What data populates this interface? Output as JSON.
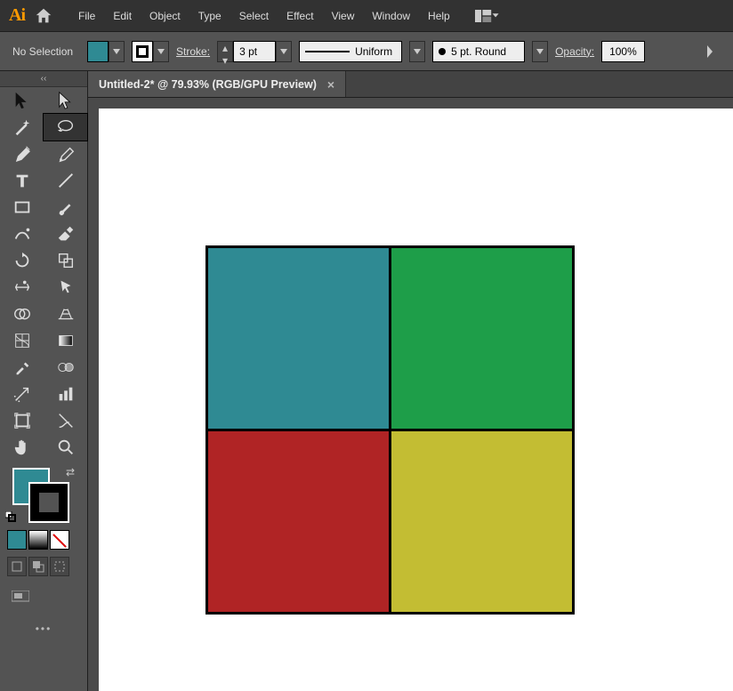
{
  "menus": [
    "File",
    "Edit",
    "Object",
    "Type",
    "Select",
    "Effect",
    "View",
    "Window",
    "Help"
  ],
  "controlbar": {
    "selection": "No Selection",
    "fill_color": "#2f8a93",
    "stroke_label": "Stroke:",
    "stroke_width": "3 pt",
    "profile_label": "Uniform",
    "brush_label": "5 pt. Round",
    "opacity_label": "Opacity:",
    "opacity_value": "100%"
  },
  "tab": {
    "title": "Untitled-2* @ 79.93% (RGB/GPU Preview)"
  },
  "tools_left": [
    "selection",
    "direct-selection",
    "magic-wand",
    "lasso",
    "pen",
    "curvature",
    "type",
    "line-segment",
    "rectangle",
    "paintbrush",
    "shaper",
    "eraser",
    "rotate",
    "scale",
    "width",
    "free-transform",
    "shape-builder",
    "perspective-grid",
    "mesh",
    "gradient",
    "eyedropper",
    "blend",
    "symbol-sprayer",
    "column-graph",
    "artboard",
    "slice",
    "hand",
    "zoom"
  ],
  "artwork": {
    "squares": [
      {
        "pos": "tl",
        "fill": "#2f8a93"
      },
      {
        "pos": "tr",
        "fill": "#1e9e49"
      },
      {
        "pos": "bl",
        "fill": "#b02425"
      },
      {
        "pos": "br",
        "fill": "#c3bd33"
      }
    ],
    "stroke": "#000"
  }
}
